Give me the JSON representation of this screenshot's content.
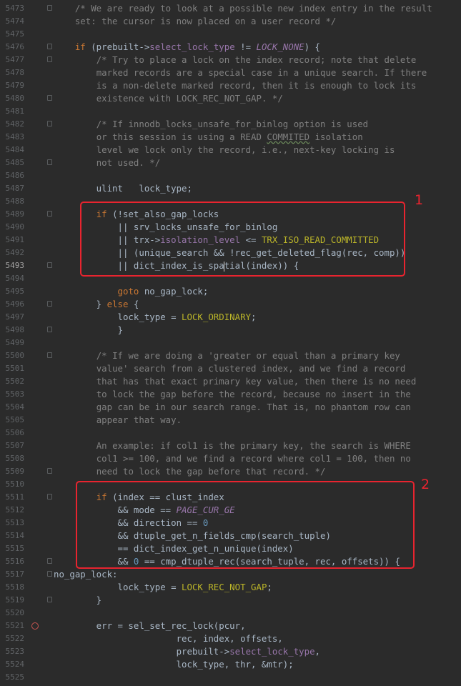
{
  "editor": {
    "current_line": 5493,
    "annotations": [
      {
        "label": "1"
      },
      {
        "label": "2"
      }
    ],
    "lines": [
      {
        "num": "5473",
        "tokens": [
          {
            "t": "    "
          },
          {
            "t": "/* We are ready to look at a possible new index entry in the result",
            "c": "cm"
          }
        ]
      },
      {
        "num": "5474",
        "tokens": [
          {
            "t": "    "
          },
          {
            "t": "set: the cursor is now placed on a user record */",
            "c": "cm"
          }
        ]
      },
      {
        "num": "5475",
        "tokens": []
      },
      {
        "num": "5476",
        "tokens": [
          {
            "t": "    "
          },
          {
            "t": "if",
            "c": "kw"
          },
          {
            "t": " (prebuilt->"
          },
          {
            "t": "select_lock_type",
            "c": "fld"
          },
          {
            "t": " != "
          },
          {
            "t": "LOCK_NONE",
            "c": "it"
          },
          {
            "t": ") {"
          }
        ]
      },
      {
        "num": "5477",
        "tokens": [
          {
            "t": "        "
          },
          {
            "t": "/* Try to place a lock on the index record; note that delete",
            "c": "cm"
          }
        ]
      },
      {
        "num": "5478",
        "tokens": [
          {
            "t": "        "
          },
          {
            "t": "marked records are a special case in a unique search. If there",
            "c": "cm"
          }
        ]
      },
      {
        "num": "5479",
        "tokens": [
          {
            "t": "        "
          },
          {
            "t": "is a non-delete marked record, then it is enough to lock its",
            "c": "cm"
          }
        ]
      },
      {
        "num": "5480",
        "tokens": [
          {
            "t": "        "
          },
          {
            "t": "existence with LOCK_REC_NOT_GAP. */",
            "c": "cm"
          }
        ]
      },
      {
        "num": "5481",
        "tokens": []
      },
      {
        "num": "5482",
        "tokens": [
          {
            "t": "        "
          },
          {
            "t": "/* If innodb_locks_unsafe_for_binlog option is used",
            "c": "cm"
          }
        ]
      },
      {
        "num": "5483",
        "tokens": [
          {
            "t": "        "
          },
          {
            "t": "or this session is using a READ ",
            "c": "cm"
          },
          {
            "t": "COMMITED",
            "c": "cm wavy"
          },
          {
            "t": " isolation",
            "c": "cm"
          }
        ]
      },
      {
        "num": "5484",
        "tokens": [
          {
            "t": "        "
          },
          {
            "t": "level we lock only the record, i.e., next-key locking is",
            "c": "cm"
          }
        ]
      },
      {
        "num": "5485",
        "tokens": [
          {
            "t": "        "
          },
          {
            "t": "not used. */",
            "c": "cm"
          }
        ]
      },
      {
        "num": "5486",
        "tokens": []
      },
      {
        "num": "5487",
        "tokens": [
          {
            "t": "        ulint   lock_type;"
          }
        ]
      },
      {
        "num": "5488",
        "tokens": []
      },
      {
        "num": "5489",
        "tokens": [
          {
            "t": "        "
          },
          {
            "t": "if",
            "c": "kw"
          },
          {
            "t": " (!set_also_gap_locks"
          }
        ]
      },
      {
        "num": "5490",
        "tokens": [
          {
            "t": "            || srv_locks_unsafe_for_binlog"
          }
        ]
      },
      {
        "num": "5491",
        "tokens": [
          {
            "t": "            || trx->"
          },
          {
            "t": "isolation_level",
            "c": "fld"
          },
          {
            "t": " <= "
          },
          {
            "t": "TRX_ISO_READ_COMMITTED",
            "c": "mac"
          }
        ]
      },
      {
        "num": "5492",
        "tokens": [
          {
            "t": "            || (unique_search && !rec_get_deleted_flag(rec, comp))"
          }
        ]
      },
      {
        "num": "5493",
        "tokens": [
          {
            "t": "            || dict_index_is_spa"
          },
          {
            "caret": true
          },
          {
            "t": "tial(index)) {"
          }
        ]
      },
      {
        "num": "5494",
        "tokens": []
      },
      {
        "num": "5495",
        "tokens": [
          {
            "t": "            "
          },
          {
            "t": "goto",
            "c": "kw"
          },
          {
            "t": " no_gap_lock;"
          }
        ]
      },
      {
        "num": "5496",
        "tokens": [
          {
            "t": "        } "
          },
          {
            "t": "else",
            "c": "kw"
          },
          {
            "t": " {"
          }
        ]
      },
      {
        "num": "5497",
        "tokens": [
          {
            "t": "            lock_type = "
          },
          {
            "t": "LOCK_ORDINARY",
            "c": "mac"
          },
          {
            "t": ";"
          }
        ]
      },
      {
        "num": "5498",
        "tokens": [
          {
            "t": "            }"
          }
        ]
      },
      {
        "num": "5499",
        "tokens": []
      },
      {
        "num": "5500",
        "tokens": [
          {
            "t": "        "
          },
          {
            "t": "/* If we are doing a 'greater or equal than a primary key",
            "c": "cm"
          }
        ]
      },
      {
        "num": "5501",
        "tokens": [
          {
            "t": "        "
          },
          {
            "t": "value' search from a clustered index, and we find a record",
            "c": "cm"
          }
        ]
      },
      {
        "num": "5502",
        "tokens": [
          {
            "t": "        "
          },
          {
            "t": "that has that exact primary key value, then there is no need",
            "c": "cm"
          }
        ]
      },
      {
        "num": "5503",
        "tokens": [
          {
            "t": "        "
          },
          {
            "t": "to lock the gap before the record, because no insert in the",
            "c": "cm"
          }
        ]
      },
      {
        "num": "5504",
        "tokens": [
          {
            "t": "        "
          },
          {
            "t": "gap can be in our search range. That is, no phantom row can",
            "c": "cm"
          }
        ]
      },
      {
        "num": "5505",
        "tokens": [
          {
            "t": "        "
          },
          {
            "t": "appear that way.",
            "c": "cm"
          }
        ]
      },
      {
        "num": "5506",
        "tokens": []
      },
      {
        "num": "5507",
        "tokens": [
          {
            "t": "        "
          },
          {
            "t": "An example: if col1 is the primary key, the search is WHERE",
            "c": "cm"
          }
        ]
      },
      {
        "num": "5508",
        "tokens": [
          {
            "t": "        "
          },
          {
            "t": "col1 >= 100, and we find a record where col1 = 100, then no",
            "c": "cm"
          }
        ]
      },
      {
        "num": "5509",
        "tokens": [
          {
            "t": "        "
          },
          {
            "t": "need to lock the gap before that record. */",
            "c": "cm"
          }
        ]
      },
      {
        "num": "5510",
        "tokens": []
      },
      {
        "num": "5511",
        "tokens": [
          {
            "t": "        "
          },
          {
            "t": "if",
            "c": "kw"
          },
          {
            "t": " (index == clust_index"
          }
        ]
      },
      {
        "num": "5512",
        "tokens": [
          {
            "t": "            && mode == "
          },
          {
            "t": "PAGE_CUR_GE",
            "c": "it"
          }
        ]
      },
      {
        "num": "5513",
        "tokens": [
          {
            "t": "            && direction == "
          },
          {
            "t": "0",
            "c": "num"
          }
        ]
      },
      {
        "num": "5514",
        "tokens": [
          {
            "t": "            && dtuple_get_n_fields_cmp(search_tuple)"
          }
        ]
      },
      {
        "num": "5515",
        "tokens": [
          {
            "t": "            == dict_index_get_n_unique(index)"
          }
        ]
      },
      {
        "num": "5516",
        "tokens": [
          {
            "t": "            && "
          },
          {
            "t": "0",
            "c": "num"
          },
          {
            "t": " == cmp_dtuple_rec(search_tuple, rec, offsets)) {"
          }
        ]
      },
      {
        "num": "5517",
        "tokens": [
          {
            "t": "no_gap_lock:"
          }
        ]
      },
      {
        "num": "5518",
        "tokens": [
          {
            "t": "            lock_type = "
          },
          {
            "t": "LOCK_REC_NOT_GAP",
            "c": "mac"
          },
          {
            "t": ";"
          }
        ]
      },
      {
        "num": "5519",
        "tokens": [
          {
            "t": "        }"
          }
        ]
      },
      {
        "num": "5520",
        "tokens": []
      },
      {
        "num": "5521",
        "tokens": [
          {
            "t": "        err = sel_set_rec_lock(pcur,"
          }
        ]
      },
      {
        "num": "5522",
        "tokens": [
          {
            "t": "                       rec, index, offsets,"
          }
        ]
      },
      {
        "num": "5523",
        "tokens": [
          {
            "t": "                       prebuilt->"
          },
          {
            "t": "select_lock_type",
            "c": "fld"
          },
          {
            "t": ","
          }
        ]
      },
      {
        "num": "5524",
        "tokens": [
          {
            "t": "                       lock_type, thr, &mtr);"
          }
        ]
      },
      {
        "num": "5525",
        "tokens": []
      }
    ]
  }
}
